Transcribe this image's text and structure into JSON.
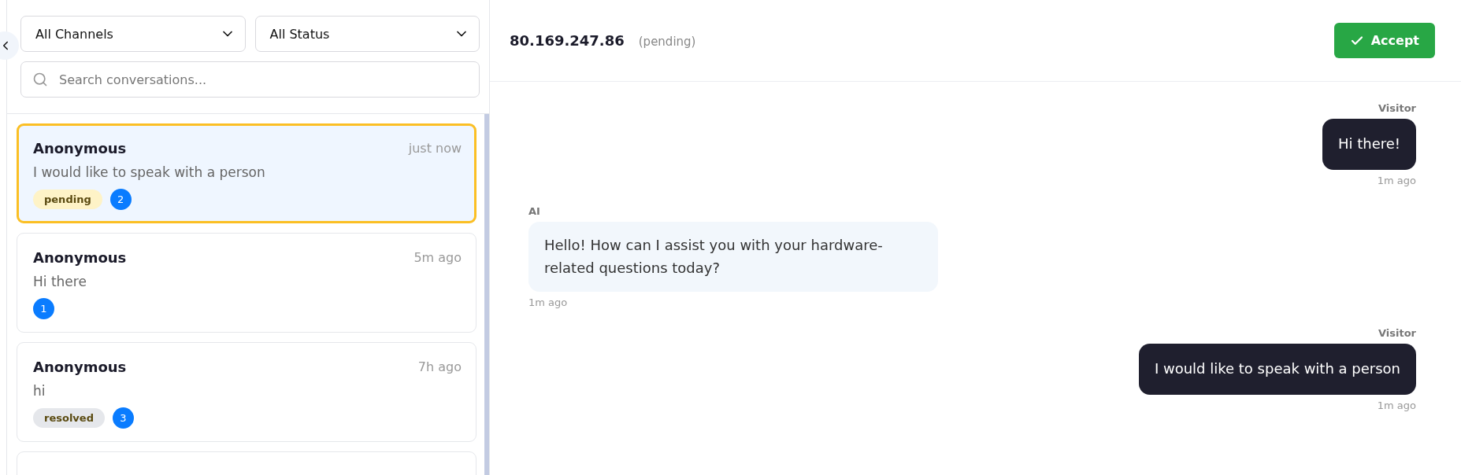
{
  "filters": [
    {
      "value": "All Channels"
    },
    {
      "value": "All Status"
    }
  ],
  "search": {
    "placeholder": "Search conversations..."
  },
  "conversations": [
    {
      "name": "Anonymous",
      "time": "just now",
      "preview": "I would like to speak with a person",
      "status": {
        "label": "pending",
        "color": "#fef3c7"
      },
      "unread": "2",
      "selected": true
    },
    {
      "name": "Anonymous",
      "time": "5m ago",
      "preview": "Hi there",
      "unread": "1",
      "selected": false
    },
    {
      "name": "Anonymous",
      "time": "7h ago",
      "preview": "hi",
      "status": {
        "label": "resolved",
        "color": "#e5e7eb"
      },
      "unread": "3",
      "selected": false
    }
  ],
  "chat": {
    "title": "80.169.247.86",
    "status": "(pending)",
    "action": "Accept",
    "messages": [
      {
        "kind": "visitor",
        "sender": "Visitor",
        "text": "Hi there!",
        "time": "1m ago"
      },
      {
        "kind": "ai",
        "sender": "AI",
        "text": "Hello! How can I assist you with your hardware-related questions today?",
        "time": "1m ago"
      },
      {
        "kind": "visitor",
        "sender": "Visitor",
        "text": "I would like to speak with a person",
        "time": "1m ago"
      }
    ]
  }
}
